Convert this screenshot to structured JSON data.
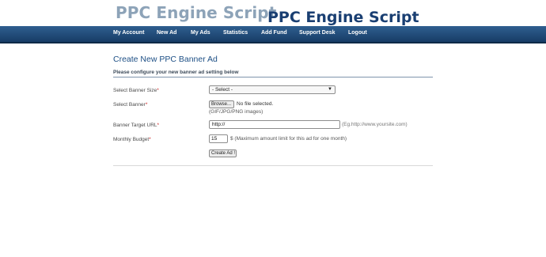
{
  "header": {
    "logo_text": "PPC Engine Script",
    "logo_overlay_text": "PPC Engine Script"
  },
  "nav": {
    "items": [
      {
        "label": "My Account"
      },
      {
        "label": "New Ad"
      },
      {
        "label": "My Ads"
      },
      {
        "label": "Statistics"
      },
      {
        "label": "Add Fund"
      },
      {
        "label": "Support Desk"
      },
      {
        "label": "Logout"
      }
    ]
  },
  "main": {
    "title": "Create New PPC Banner Ad",
    "subtitle": "Please configure your new banner ad setting below"
  },
  "form": {
    "banner_size": {
      "label": "Select Banner Size",
      "required_mark": "*",
      "selected": "- Select -"
    },
    "banner": {
      "label": "Select Banner",
      "required_mark": "*",
      "browse_label": "Browse...",
      "file_status": "No file selected.",
      "hint": "(GIF/JPG/PNG images)"
    },
    "target_url": {
      "label": "Banner Target URL",
      "required_mark": "*",
      "value": "http://",
      "hint": "(Eg.http://www.yoursite.com)"
    },
    "budget": {
      "label": "Monthly Budget",
      "required_mark": "*",
      "value": "15",
      "hint": "$ (Maximum amount limit for this ad for one month)"
    },
    "submit_label": "Create Ad !"
  }
}
